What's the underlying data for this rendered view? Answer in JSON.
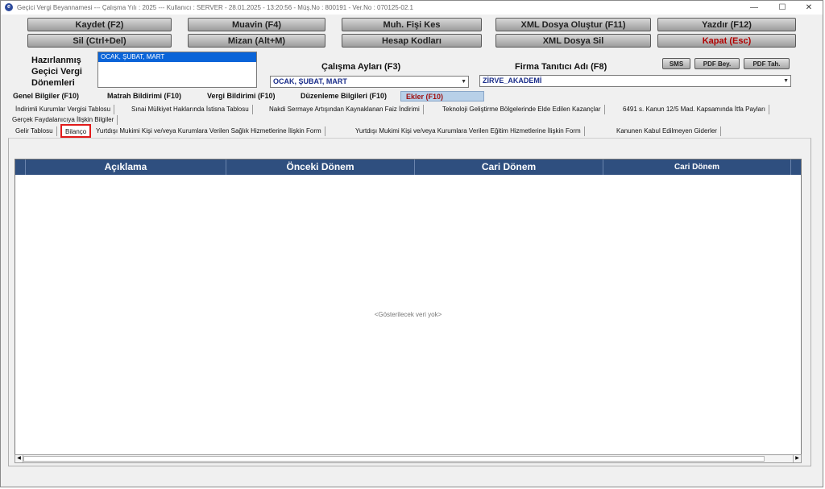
{
  "window": {
    "title": "Geçici Vergi Beyannamesi   ---  Çalışma Yılı : 2025   ---   Kullanıcı : SERVER - 28.01.2025 - 13:20:56  - Müş.No : 800191  - Ver.No : 070125-02.1",
    "minimize": "—",
    "maximize": "☐",
    "close": "✕"
  },
  "toolbar": {
    "kaydet": "Kaydet (F2)",
    "muavin": "Muavin (F4)",
    "muh_fisi_kes": "Muh. Fişi Kes",
    "xml_olustur": "XML Dosya Oluştur (F11)",
    "yazdir": "Yazdır (F12)",
    "sil": "Sil (Ctrl+Del)",
    "mizan": "Mizan (Alt+M)",
    "hesap_kodlari": "Hesap Kodları",
    "xml_sil": "XML Dosya Sil",
    "kapat": "Kapat (Esc)"
  },
  "periods": {
    "label_line1": "Hazırlanmış",
    "label_line2": "Geçici Vergi",
    "label_line3": "Dönemleri",
    "selected": "OCAK, ŞUBAT, MART"
  },
  "months": {
    "label": "Çalışma Ayları (F3)",
    "value": "OCAK, ŞUBAT, MART"
  },
  "company": {
    "label": "Firma Tanıtıcı Adı (F8)",
    "value": "ZİRVE_AKADEMİ"
  },
  "small_buttons": {
    "sms": "SMS",
    "pdf_bey": "PDF Bey.",
    "pdf_tah": "PDF Tah."
  },
  "main_tabs": [
    "Genel Bilgiler (F10)",
    "Matrah Bildirimi (F10)",
    "Vergi Bildirimi (F10)",
    "Düzenleme Bilgileri (F10)",
    "Ekler (F10)"
  ],
  "sub_tabs_row1": [
    "İndirimli Kurumlar Vergisi Tablosu",
    "Sınai Mülkiyet Haklarında İstisna Tablosu",
    "Nakdi Sermaye Artışından Kaynaklanan Faiz İndirimi",
    "Teknoloji Geliştirme Bölgelerinde Elde Edilen Kazançlar",
    "6491 s. Kanun 12/5 Mad. Kapsamında İtfa Payları"
  ],
  "sub_tabs_row2": [
    "Gerçek Faydalanıcıya İlişkin Bilgiler"
  ],
  "sub_tabs_row3": [
    "Gelir Tablosu",
    "Bilanço",
    "Yurtdışı Mukimi Kişi ve/veya Kurumlara Verilen Sağlık Hizmetlerine İlişkin Form",
    "Yurtdışı Mukimi Kişi ve/veya Kurumlara Verilen Eğitim Hizmetlerine İlişkin Form",
    "Kanunen Kabul Edilmeyen Giderler"
  ],
  "grid": {
    "columns": [
      "Açıklama",
      "Önceki Dönem",
      "Cari Dönem",
      "Cari Dönem"
    ],
    "empty_text": "<Gösterilecek veri yok>"
  },
  "colors": {
    "header_bg": "#2f4f7f",
    "selected_tab": "#b8d0e8",
    "highlight_box": "#e11b1b"
  },
  "icons": [
    "app-icon",
    "minimize-icon",
    "maximize-icon",
    "close-icon",
    "dropdown-arrow-icon",
    "scroll-left-icon",
    "scroll-right-icon"
  ]
}
